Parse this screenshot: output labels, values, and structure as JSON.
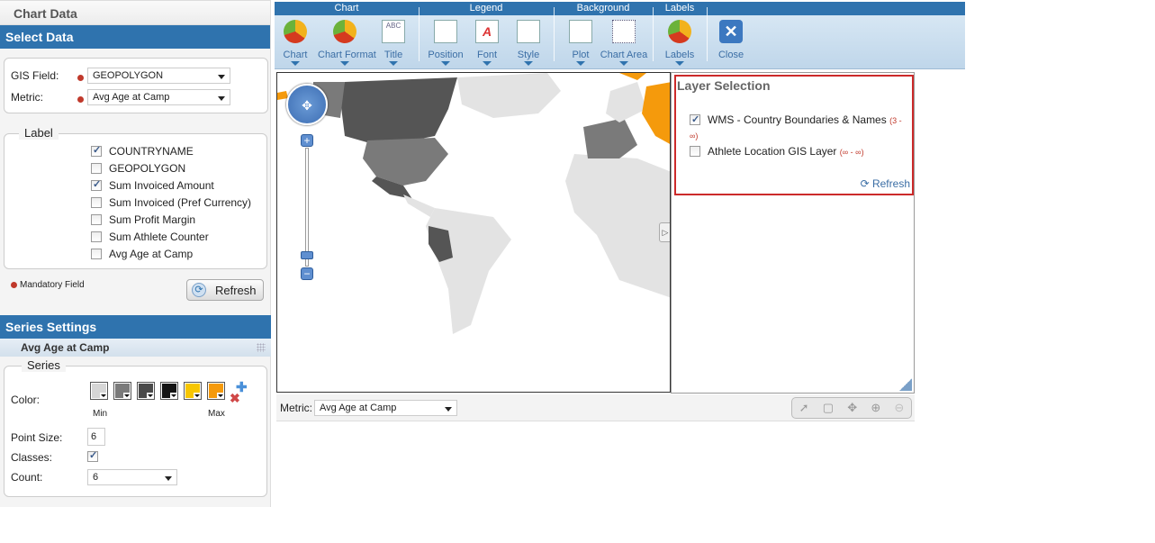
{
  "left_panel": {
    "title": "Chart Data",
    "select_data": {
      "header": "Select Data",
      "gis_field_label": "GIS Field:",
      "gis_field_value": "GEOPOLYGON",
      "metric_label": "Metric:",
      "metric_value": "Avg Age at Camp"
    },
    "label_group": {
      "legend": "Label",
      "items": [
        {
          "label": "COUNTRYNAME",
          "checked": true
        },
        {
          "label": "GEOPOLYGON",
          "checked": false
        },
        {
          "label": "Sum Invoiced Amount",
          "checked": true
        },
        {
          "label": "Sum Invoiced (Pref Currency)",
          "checked": false
        },
        {
          "label": "Sum Profit Margin",
          "checked": false
        },
        {
          "label": "Sum Athlete Counter",
          "checked": false
        },
        {
          "label": "Avg Age at Camp",
          "checked": false
        }
      ]
    },
    "mandatory_note": "Mandatory Field",
    "refresh_label": "Refresh",
    "series_settings": {
      "header": "Series Settings",
      "series_name": "Avg Age at Camp",
      "legend": "Series",
      "color_label": "Color:",
      "colors": [
        "#d6d6d6",
        "#7a7a7a",
        "#4a4a4a",
        "#141414",
        "#f7c600",
        "#f59a0c"
      ],
      "min_label": "Min",
      "max_label": "Max",
      "point_size_label": "Point Size:",
      "point_size_value": "6",
      "classes_label": "Classes:",
      "classes_checked": true,
      "count_label": "Count:",
      "count_value": "6"
    }
  },
  "toolbar": {
    "groups": [
      "Chart",
      "Legend",
      "Background",
      "Labels"
    ],
    "buttons": [
      {
        "label": "Chart",
        "icon": "pie-chart-icon"
      },
      {
        "label": "Chart Format",
        "icon": "chart-format-icon"
      },
      {
        "label": "Title",
        "icon": "title-icon"
      },
      {
        "label": "Position",
        "icon": "legend-position-icon"
      },
      {
        "label": "Font",
        "icon": "font-icon"
      },
      {
        "label": "Style",
        "icon": "legend-style-icon"
      },
      {
        "label": "Plot",
        "icon": "plot-background-icon"
      },
      {
        "label": "Chart Area",
        "icon": "chart-area-icon"
      },
      {
        "label": "Labels",
        "icon": "labels-icon"
      },
      {
        "label": "Close",
        "icon": "close-icon"
      }
    ]
  },
  "layer_selection": {
    "title": "Layer Selection",
    "layers": [
      {
        "label": "WMS - Country Boundaries & Names",
        "range": "(3 - ∞)",
        "checked": true
      },
      {
        "label": "Athlete Location GIS Layer",
        "range": "(∞ - ∞)",
        "checked": false
      }
    ],
    "refresh_label": "Refresh"
  },
  "bottom_bar": {
    "metric_label": "Metric:",
    "metric_value": "Avg Age at Camp"
  }
}
